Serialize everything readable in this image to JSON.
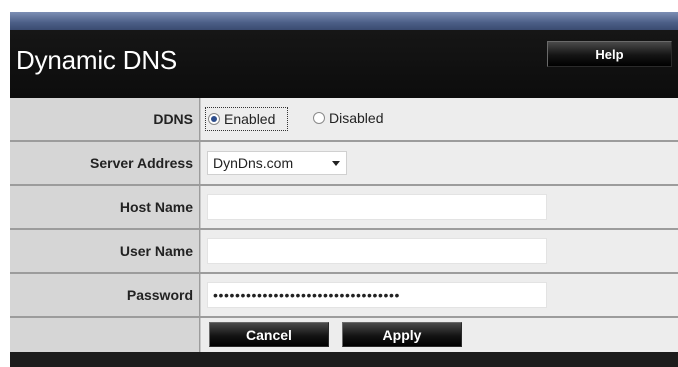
{
  "header": {
    "title": "Dynamic DNS",
    "help_label": "Help"
  },
  "form": {
    "ddns": {
      "label": "DDNS",
      "options": [
        {
          "label": "Enabled",
          "selected": true
        },
        {
          "label": "Disabled",
          "selected": false
        }
      ]
    },
    "server_address": {
      "label": "Server Address",
      "value": "DynDns.com"
    },
    "host_name": {
      "label": "Host Name",
      "value": ""
    },
    "user_name": {
      "label": "User Name",
      "value": ""
    },
    "password": {
      "label": "Password",
      "masked_value": "••••••••••••••••••••••••••••••••••"
    }
  },
  "actions": {
    "cancel_label": "Cancel",
    "apply_label": "Apply"
  },
  "colors": {
    "accent_bar": "#4b5e86",
    "header_bg": "#111111",
    "label_bg": "#d6d6d6",
    "value_bg": "#ededed",
    "radio_dot": "#2d4d8c"
  }
}
